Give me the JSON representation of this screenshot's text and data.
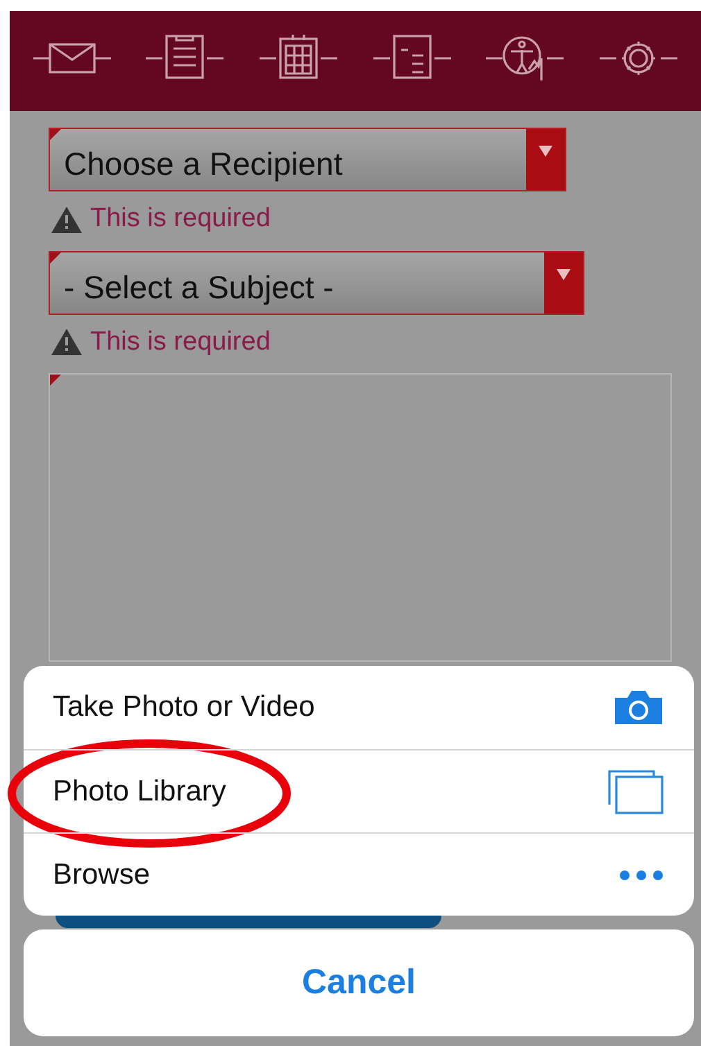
{
  "header": {
    "icons": [
      {
        "kind": "mail"
      },
      {
        "kind": "clipboard"
      },
      {
        "kind": "calendar"
      },
      {
        "kind": "bill"
      },
      {
        "kind": "body"
      },
      {
        "kind": "gear"
      }
    ]
  },
  "form": {
    "fields": [
      {
        "kind": "select",
        "value": "Choose a Recipient",
        "error": "This is required"
      },
      {
        "kind": "select",
        "value": "- Select a Subject -",
        "error": "This is required"
      },
      {
        "kind": "textarea"
      }
    ]
  },
  "action_sheet": {
    "items": [
      {
        "label": "Take Photo or Video",
        "kind": "camera",
        "highlighted": false
      },
      {
        "label": "Photo Library",
        "kind": "library",
        "highlighted": true
      },
      {
        "label": "Browse",
        "kind": "more",
        "highlighted": false
      }
    ],
    "cancel": "Cancel"
  }
}
